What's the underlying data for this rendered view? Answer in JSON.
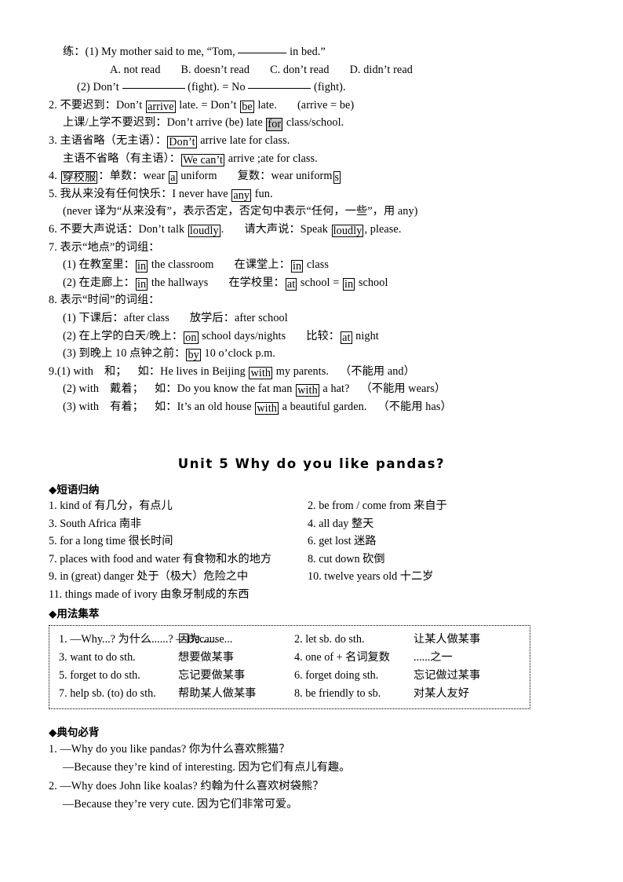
{
  "top_section": {
    "practice_label": "练：",
    "q1": {
      "prefix": "(1) My mother said to me, “Tom,",
      "suffix": "in bed.”",
      "options": [
        "A. not read",
        "B. doesn’t read",
        "C. don’t read",
        "D. didn’t read"
      ]
    },
    "q2": {
      "p1": "(2) Don’t",
      "p2": "(fight). = No",
      "p3": "(fight)."
    },
    "items": [
      {
        "num": "2.",
        "cn": "不要迟到：",
        "lines": [
          {
            "pre": "Don’t ",
            "box1": "arrive",
            "mid": " late. = Don’t ",
            "box2": "be",
            "post": " late.",
            "tail": "(arrive = be)"
          },
          {
            "cn2": "上课/上学不要迟到：",
            "pre": "Don’t arrive (be) late ",
            "box1": "for",
            "boxshade": true,
            "mid": " class/school."
          }
        ]
      },
      {
        "num": "3.",
        "cn": "主语省略（无主语）：",
        "lines": [
          {
            "box1": "Don’t",
            "mid": " arrive late for class."
          },
          {
            "cn2": "主语不省略（有主语）：",
            "box1": "We can’t",
            "mid": " arrive ;ate for class."
          }
        ]
      },
      {
        "num": "4.",
        "cnbox": "穿校服",
        "rest_a": "：单数：wear ",
        "box_a": "a",
        "rest_b": " uniform",
        "rest_c": "复数：wear uniform",
        "box_b": "s"
      },
      {
        "num": "5.",
        "cn": "我从来没有任何快乐：",
        "pre": "I never have ",
        "box1": "any",
        "post": " fun.",
        "note": "(never 译为“从来没有”，表示否定，否定句中表示“任何，一些”，用 any)"
      },
      {
        "num": "6.",
        "cn": "不要大声说话：",
        "pre": "Don’t talk ",
        "box1": "loudly",
        "post": ".",
        "cn2": "请大声说：",
        "pre2": "Speak ",
        "box2": "loudly",
        "post2": ", please."
      },
      {
        "num": "7.",
        "cn": "表示“地点”的词组：",
        "subs": [
          {
            "label": "(1) 在教室里：",
            "box": "in",
            "text": " the classroom",
            "label2": "在课堂上：",
            "box2": "in",
            "text2": " class"
          },
          {
            "label": "(2) 在走廊上：",
            "box": "in",
            "text": " the hallways",
            "label2": "在学校里：",
            "box2": "at",
            "text2": " school = ",
            "box3": "in",
            "text3": " school"
          }
        ]
      },
      {
        "num": "8.",
        "cn": "表示“时间”的词组：",
        "subs": [
          {
            "label": "(1) 下课后：after class",
            "label2": "放学后：after school"
          },
          {
            "label": "(2) 在上学的白天/晚上：",
            "box": "on",
            "text": " school days/nights",
            "label2": "比较：",
            "box2": "at",
            "text2": " night"
          },
          {
            "label": "(3) 到晚上 10 点钟之前：",
            "box": "by",
            "text": " 10 o’clock p.m."
          }
        ]
      },
      {
        "num": "9.",
        "withs": [
          {
            "head": "(1) with",
            "cn": "和；",
            "eg": "如：",
            "pre": "He lives in Beijing ",
            "box": "with",
            "post": " my parents.",
            "note": "（不能用 and）"
          },
          {
            "head": "(2) with",
            "cn": "戴着；",
            "eg": "如：",
            "pre": "Do you know the fat man ",
            "box": "with",
            "post": " a hat?",
            "note": "（不能用 wears）"
          },
          {
            "head": "(3) with",
            "cn": "有着；",
            "eg": "如：",
            "pre": "It’s an old house ",
            "box": "with",
            "post": " a beautiful garden.",
            "note": "（不能用 has）"
          }
        ]
      }
    ]
  },
  "unit": {
    "title": "Unit 5   Why do you like pandas?"
  },
  "phrases_section": {
    "heading": "◆短语归纳",
    "rows": [
      [
        "1. kind of  有几分，有点儿",
        "2. be from / come from  来自于"
      ],
      [
        "3. South Africa 南非",
        "4. all day 整天"
      ],
      [
        "5. for a long time 很长时间",
        "6. get lost 迷路"
      ],
      [
        "7. places with food and water 有食物和水的地方",
        "8. cut down 砍倒"
      ],
      [
        "9. in (great) danger 处于（极大）危险之中",
        "10. twelve years old 十二岁"
      ],
      [
        "11. things made of ivory 由象牙制成的东西",
        ""
      ]
    ]
  },
  "usage_section": {
    "heading": "◆用法集萃",
    "rows": [
      {
        "a1": "1. —Why...? 为什么......? —Because...",
        "a2": "因为......",
        "b1": "2. let sb. do sth.",
        "b2": "让某人做某事"
      },
      {
        "a1": "3. want to do sth.",
        "a2": "想要做某事",
        "b1": "4. one of + 名词复数",
        "b2": "......之一"
      },
      {
        "a1": "5. forget to do sth.",
        "a2": "忘记要做某事",
        "b1": "6. forget doing sth.",
        "b2": "忘记做过某事"
      },
      {
        "a1": "7. help sb. (to) do sth.",
        "a2": "帮助某人做某事",
        "b1": "8. be friendly to sb.",
        "b2": "对某人友好"
      }
    ]
  },
  "sentences_section": {
    "heading": "◆典句必背",
    "items": [
      {
        "q": "1. —Why do you like pandas?  你为什么喜欢熊猫？",
        "a": "—Because they’re kind of interesting.  因为它们有点儿有趣。"
      },
      {
        "q": "2. —Why does John like koalas?  约翰为什么喜欢树袋熊？",
        "a": "—Because they’re very cute.  因为它们非常可爱。"
      }
    ]
  }
}
